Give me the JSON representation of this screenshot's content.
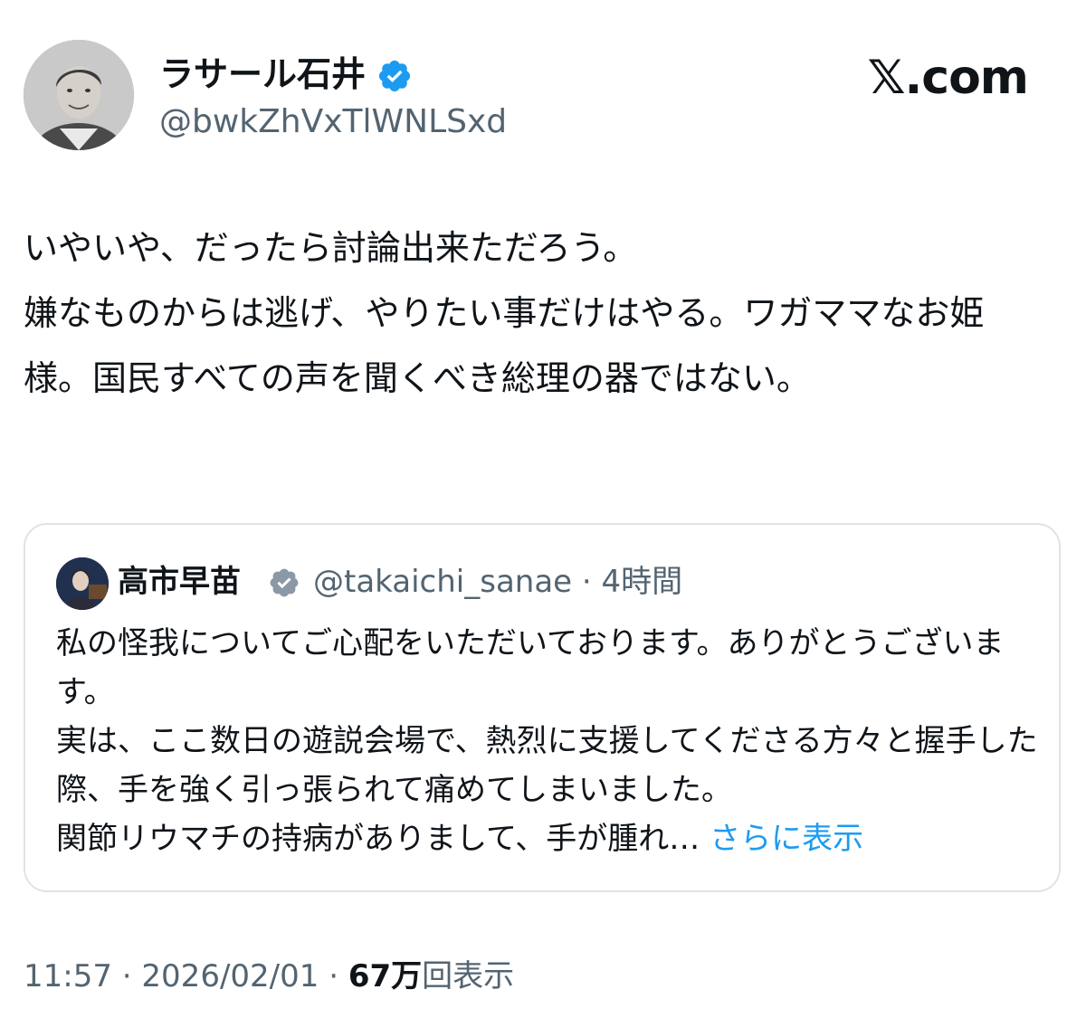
{
  "author": {
    "display_name": "ラサール石井",
    "handle": "@bwkZhVxTlWNLSxd",
    "verified": true,
    "avatar_icon": "profile-photo"
  },
  "brand": {
    "label": "𝕏.com",
    "icon": "x-logo"
  },
  "tweet": {
    "text": "いやいや、だったら討論出来ただろう。\n嫌なものからは逃げ、やりたい事だけはやる。ワガママなお姫様。国民すべての声を聞くべき総理の器ではない。"
  },
  "quoted_tweet": {
    "display_name": "高市早苗",
    "handle": "@takaichi_sanae",
    "separator": " · ",
    "time_ago": "4時間",
    "verified": true,
    "text": "私の怪我についてご心配をいただいております。ありがとうございます。\n実は、ここ数日の遊説会場で、熱烈に支援してくださる方々と握手した際、手を強く引っ張られて痛めてしまいました。\n関節リウマチの持病がありまして、手が腫れ…",
    "show_more": "さらに表示"
  },
  "footer": {
    "time": "11:57",
    "separator": " · ",
    "date": "2026/02/01",
    "views_count": "67万",
    "views_label": "回表示"
  },
  "colors": {
    "text_primary": "#0f1419",
    "text_secondary": "#536471",
    "verified_blue": "#1d9bf0",
    "link_blue": "#1d9bf0",
    "quote_verified_gray": "#8b98a5",
    "border": "#dfe3e6"
  }
}
